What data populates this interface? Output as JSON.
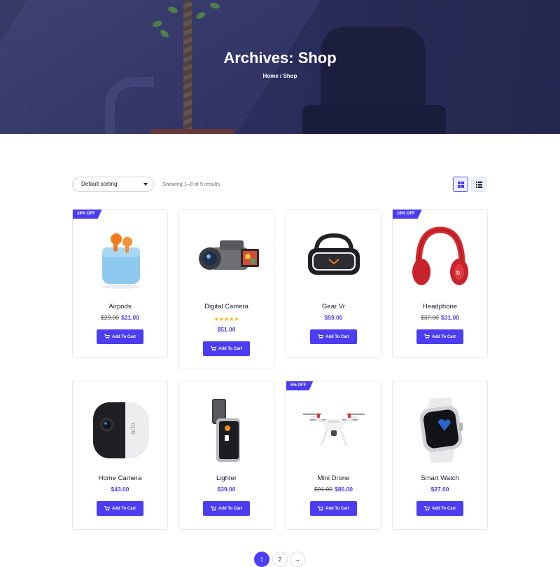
{
  "hero": {
    "title": "Archives: Shop",
    "breadcrumb": "Home / Shop"
  },
  "toolbar": {
    "sort_selected": "Default sorting",
    "results_text": "Showing 1–8 of 9 results"
  },
  "products": [
    {
      "name": "Airpods",
      "old_price": "$29.00",
      "price": "$21.00",
      "badge": "28% OFF",
      "rating": null,
      "cart_label": "Add To Cart"
    },
    {
      "name": "Digital Camera",
      "old_price": "",
      "price": "$51.00",
      "badge": "",
      "rating": 5,
      "cart_label": "Add To Cart"
    },
    {
      "name": "Gear Vr",
      "old_price": "",
      "price": "$59.00",
      "badge": "",
      "rating": null,
      "cart_label": "Add To Cart"
    },
    {
      "name": "Headphone",
      "old_price": "$37.00",
      "price": "$31.00",
      "badge": "16% OFF",
      "rating": null,
      "cart_label": "Add To Cart"
    },
    {
      "name": "Home Camera",
      "old_price": "",
      "price": "$43.00",
      "badge": "",
      "rating": null,
      "cart_label": "Add To Cart"
    },
    {
      "name": "Lighter",
      "old_price": "",
      "price": "$39.00",
      "badge": "",
      "rating": null,
      "cart_label": "Add To Cart"
    },
    {
      "name": "Mini Drone",
      "old_price": "$91.00",
      "price": "$86.00",
      "badge": "5% OFF",
      "rating": null,
      "cart_label": "Add To Cart"
    },
    {
      "name": "Smart Watch",
      "old_price": "",
      "price": "$27.00",
      "badge": "",
      "rating": null,
      "cart_label": "Add To Cart"
    }
  ],
  "rating_stars": "★★★★★",
  "pagination": {
    "page1": "1",
    "page2": "2",
    "next": "→"
  },
  "colors": {
    "accent": "#4c3df2",
    "badge_tail": "#35c8f0",
    "star": "#ffb400"
  }
}
